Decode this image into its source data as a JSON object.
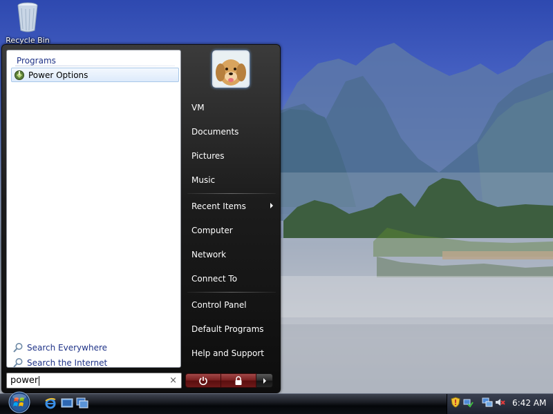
{
  "desktop": {
    "icons": [
      {
        "label": "Recycle Bin",
        "icon": "recycle-bin-icon"
      }
    ]
  },
  "start_menu": {
    "left_pane": {
      "section_header": "Programs",
      "results": [
        {
          "label": "Power Options",
          "icon": "power-options-icon",
          "selected": true
        }
      ],
      "search_links": [
        {
          "label": "Search Everywhere",
          "icon": "search-icon"
        },
        {
          "label": "Search the Internet",
          "icon": "search-icon"
        }
      ]
    },
    "search": {
      "value": "power",
      "clear_glyph": "×"
    },
    "user_picture": {
      "icon": "dog-avatar-icon"
    },
    "right_pane": {
      "group1": [
        "VM",
        "Documents",
        "Pictures",
        "Music"
      ],
      "group2": [
        "Recent Items",
        "Computer",
        "Network",
        "Connect To"
      ],
      "group3": [
        "Control Panel",
        "Default Programs",
        "Help and Support"
      ]
    },
    "power_bar": {
      "power_icon": "power-icon",
      "lock_icon": "lock-icon",
      "arrow_icon": "chevron-right-icon"
    }
  },
  "taskbar": {
    "start_icon": "windows-orb-icon",
    "quick_launch": [
      "internet-explorer-icon",
      "show-desktop-icon",
      "switch-windows-icon"
    ],
    "tray_icons": [
      "security-shield-icon",
      "network-check-icon",
      "network-icon",
      "volume-muted-icon"
    ],
    "clock": "6:42 AM"
  },
  "colors": {
    "start_menu_dark": "#1c1c1c",
    "link_blue": "#1e3287",
    "power_red": "#7a2020",
    "selection_blue": "#ddeafb"
  }
}
